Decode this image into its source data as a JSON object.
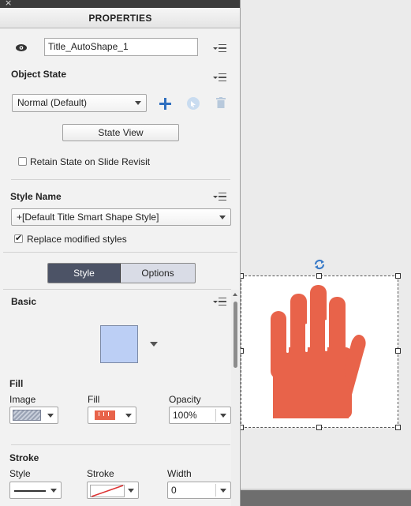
{
  "panel": {
    "title": "PROPERTIES",
    "close_glyph": "×",
    "object_name": "Title_AutoShape_1",
    "object_state": {
      "label": "Object State",
      "selected": "Normal (Default)",
      "state_view_label": "State View",
      "retain_label": "Retain State on Slide Revisit",
      "retain_checked": false
    },
    "style_name": {
      "label": "Style Name",
      "selected": "+[Default Title Smart Shape Style]",
      "replace_label": "Replace modified styles",
      "replace_checked": true
    },
    "tabs": [
      {
        "label": "Style",
        "active": true
      },
      {
        "label": "Options",
        "active": false
      }
    ],
    "basic": {
      "label": "Basic",
      "swatch_color": "#bccff5"
    },
    "fill": {
      "label": "Fill",
      "image_label": "Image",
      "fill_label": "Fill",
      "opacity_label": "Opacity",
      "opacity_value": "100%"
    },
    "stroke": {
      "label": "Stroke",
      "style_label": "Style",
      "stroke_label": "Stroke",
      "width_label": "Width",
      "width_value": "0"
    }
  },
  "stage": {
    "shape_icon": "hand-icon",
    "shape_color": "#e8634a",
    "rotate_icon": "rotate-icon",
    "rotate_color": "#3a7bc8"
  },
  "colors": {
    "accent_blue": "#2f6fbf",
    "tab_active": "#4c5366"
  }
}
